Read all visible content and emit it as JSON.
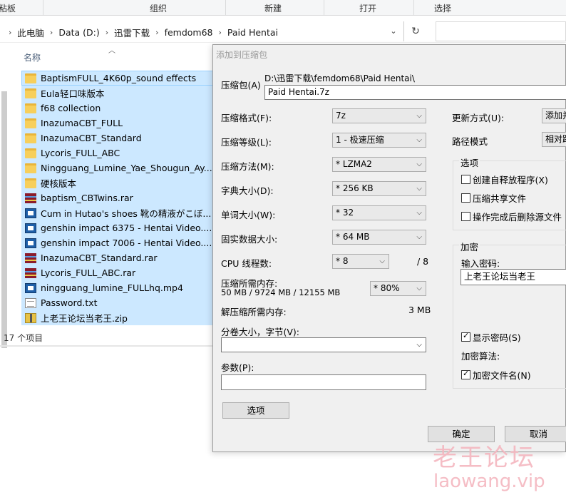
{
  "ribbon": {
    "groups": [
      "粘板",
      "组织",
      "新建",
      "打开",
      "选择"
    ]
  },
  "address": {
    "crumbs": [
      "此电脑",
      "Data (D:)",
      "迅雷下载",
      "femdom68",
      "Paid Hentai"
    ],
    "search_placeholder": ""
  },
  "explorer": {
    "column_name": "名称",
    "status": "17 个项目",
    "files": [
      {
        "name": "BaptismFULL_4K60p_sound effects",
        "type": "folder"
      },
      {
        "name": "Eula轻口味版本",
        "type": "folder"
      },
      {
        "name": "f68 collection",
        "type": "folder"
      },
      {
        "name": "InazumaCBT_FULL",
        "type": "folder"
      },
      {
        "name": "InazumaCBT_Standard",
        "type": "folder"
      },
      {
        "name": "Lycoris_FULL_ABC",
        "type": "folder"
      },
      {
        "name": "Ningguang_Lumine_Yae_Shougun_Ay...",
        "type": "folder"
      },
      {
        "name": "硬核版本",
        "type": "folder"
      },
      {
        "name": "baptism_CBTwins.rar",
        "type": "rar"
      },
      {
        "name": "Cum in Hutao's shoes 靴の精液がこぼ...",
        "type": "video"
      },
      {
        "name": "genshin impact 6375 - Hentai Video....",
        "type": "video"
      },
      {
        "name": "genshin impact 7006 - Hentai Video....",
        "type": "video"
      },
      {
        "name": "InazumaCBT_Standard.rar",
        "type": "rar"
      },
      {
        "name": "Lycoris_FULL_ABC.rar",
        "type": "rar"
      },
      {
        "name": "ningguang_lumine_FULLhq.mp4",
        "type": "video"
      },
      {
        "name": "Password.txt",
        "type": "txt"
      },
      {
        "name": "上老王论坛当老王.zip",
        "type": "zip"
      }
    ]
  },
  "dialog": {
    "title": "添加到压缩包",
    "archive_label": "压缩包(A)",
    "archive_path": "D:\\迅雷下载\\femdom68\\Paid Hentai\\",
    "archive_name": "Paid Hentai.7z",
    "format_label": "压缩格式(F):",
    "format_value": "7z",
    "level_label": "压缩等级(L):",
    "level_value": "1 - 极速压缩",
    "method_label": "压缩方法(M):",
    "method_value": "* LZMA2",
    "dict_label": "字典大小(D):",
    "dict_value": "* 256 KB",
    "word_label": "单词大小(W):",
    "word_value": "* 32",
    "solid_label": "固实数据大小:",
    "solid_value": "* 64 MB",
    "cpu_label": "CPU 线程数:",
    "cpu_value": "* 8",
    "cpu_total": "/ 8",
    "mem_label": "压缩所需内存:",
    "mem_value": "50 MB / 9724 MB / 12155 MB",
    "mem_percent": "* 80%",
    "decomp_label": "解压缩所需内存:",
    "decomp_value": "3 MB",
    "split_label": "分卷大小，字节(V):",
    "split_value": "",
    "params_label": "参数(P):",
    "params_value": "",
    "options_button": "选项",
    "update_label": "更新方式(U):",
    "update_value": "添加并",
    "path_label": "路径模式",
    "path_value": "相对路",
    "options_group": "选项",
    "opt_sfx": "创建自释放程序(X)",
    "opt_shared": "压缩共享文件",
    "opt_delete": "操作完成后删除源文件",
    "encrypt_group": "加密",
    "password_label": "输入密码:",
    "password_value": "上老王论坛当老王",
    "show_password": "显示密码(S)",
    "encrypt_method_label": "加密算法:",
    "encrypt_names": "加密文件名(N)",
    "ok_button": "确定",
    "cancel_button": "取消"
  },
  "watermark": {
    "cn": "老王论坛",
    "url": "laowang.vip"
  }
}
